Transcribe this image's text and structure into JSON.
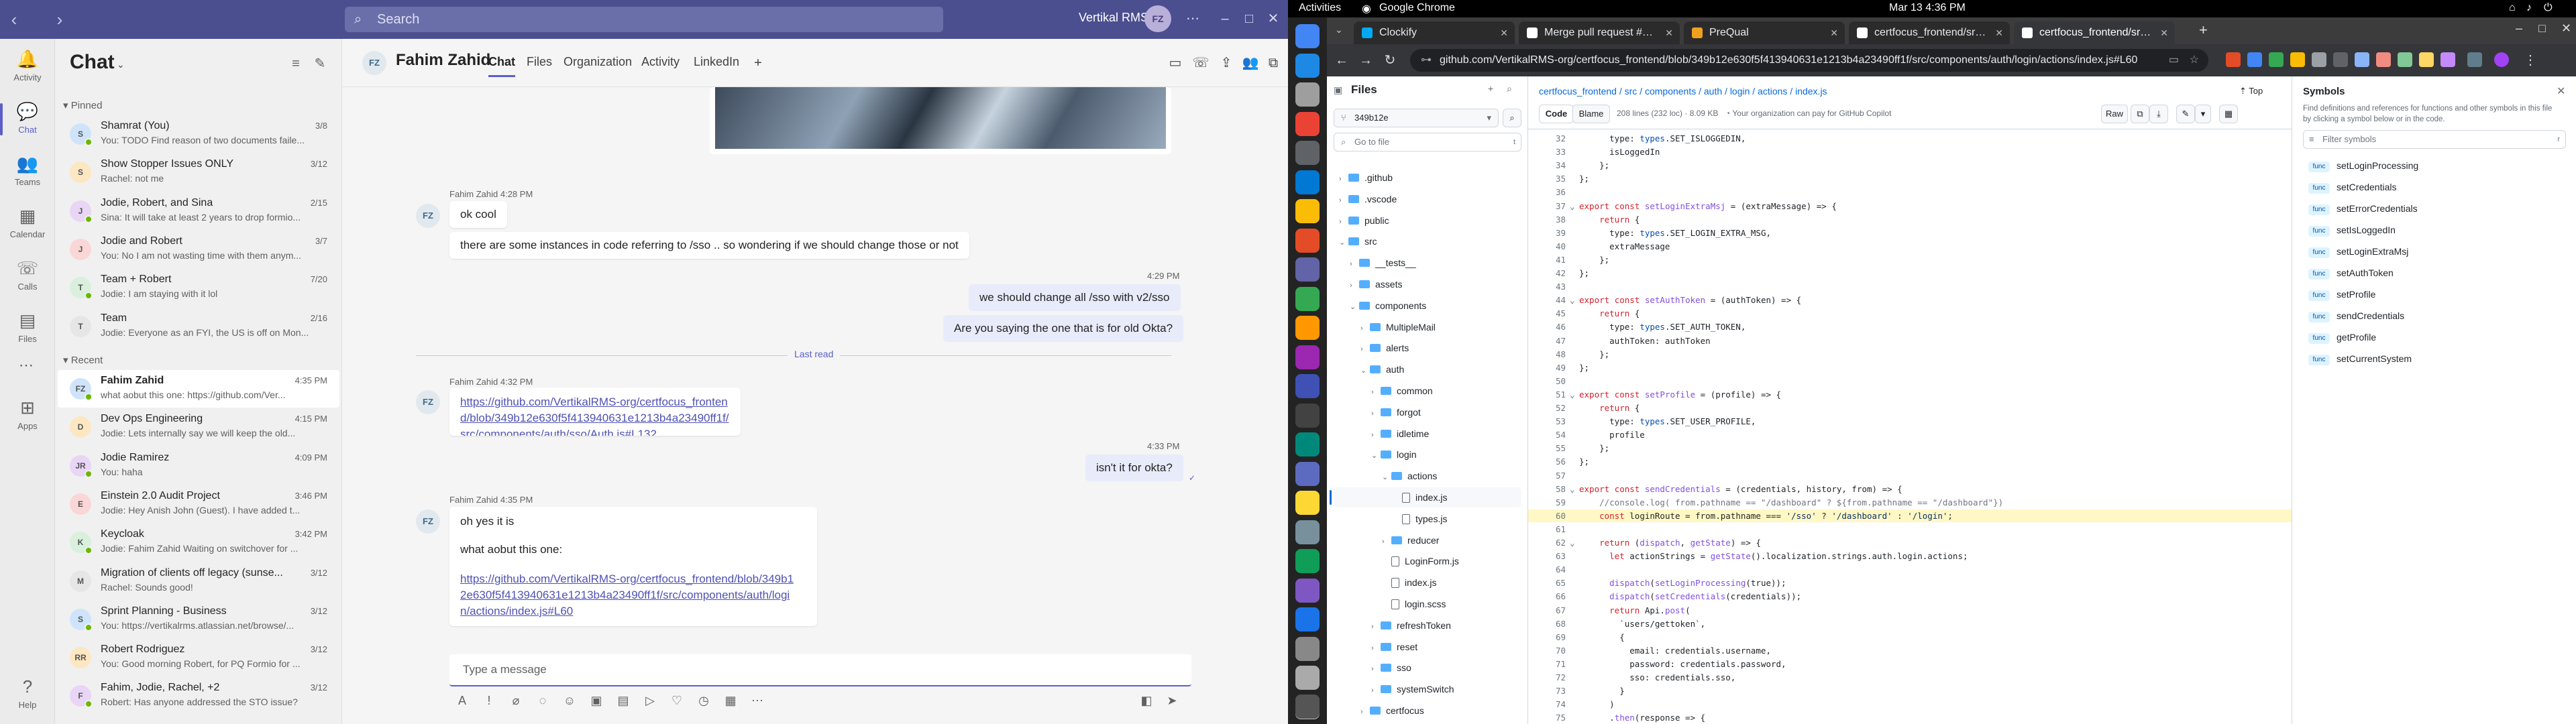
{
  "teams": {
    "titlebar": {
      "search_placeholder": "Search",
      "org": "Vertikal RMS",
      "avatar": "FZ"
    },
    "rail": [
      {
        "label": "Activity",
        "icon": "bell-icon"
      },
      {
        "label": "Chat",
        "icon": "chat-icon"
      },
      {
        "label": "Teams",
        "icon": "teams-icon"
      },
      {
        "label": "Calendar",
        "icon": "calendar-icon"
      },
      {
        "label": "Calls",
        "icon": "phone-icon"
      },
      {
        "label": "Files",
        "icon": "file-icon"
      },
      {
        "label": "Apps",
        "icon": "apps-icon"
      },
      {
        "label": "Help",
        "icon": "help-icon"
      }
    ],
    "list": {
      "title": "Chat",
      "pinned_label": "Pinned",
      "recent_label": "Recent",
      "pinned": [
        {
          "name": "Shamrat (You)",
          "time": "3/8",
          "preview": "You: TODO Find reason of two documents faile...",
          "avatar": "S"
        },
        {
          "name": "Show Stopper Issues ONLY",
          "time": "3/12",
          "preview": "Rachel: not me",
          "avatar": "S"
        },
        {
          "name": "Jodie, Robert, and Sina",
          "time": "2/15",
          "preview": "Sina: It will take at least 2 years to drop formio...",
          "avatar": "J"
        },
        {
          "name": "Jodie and Robert",
          "time": "3/7",
          "preview": "You: No I am not wasting time with them anym...",
          "avatar": "J"
        },
        {
          "name": "Team + Robert",
          "time": "7/20",
          "preview": "Jodie: I am staying with it lol",
          "avatar": "T"
        },
        {
          "name": "Team",
          "time": "2/16",
          "preview": "Jodie: Everyone as an FYI, the US is off on Mon...",
          "avatar": "T"
        }
      ],
      "recent": [
        {
          "name": "Fahim Zahid",
          "time": "4:35 PM",
          "preview": "what aobut this one: https://github.com/Ver...",
          "avatar": "FZ"
        },
        {
          "name": "Dev Ops Engineering",
          "time": "4:15 PM",
          "preview": "Jodie: Lets internally say we will keep the old...",
          "avatar": "D"
        },
        {
          "name": "Jodie Ramirez",
          "time": "4:09 PM",
          "preview": "You: haha",
          "avatar": "JR"
        },
        {
          "name": "Einstein 2.0 Audit Project",
          "time": "3:46 PM",
          "preview": "Jodie: Hey Anish John (Guest). I have added t...",
          "avatar": "E"
        },
        {
          "name": "Keycloak",
          "time": "3:42 PM",
          "preview": "Jodie: Fahim Zahid Waiting on switchover for ...",
          "avatar": "K"
        },
        {
          "name": "Migration of clients off legacy (sunse...",
          "time": "3/12",
          "preview": "Rachel: Sounds good!",
          "avatar": "M"
        },
        {
          "name": "Sprint Planning - Business",
          "time": "3/12",
          "preview": "You: https://vertikalrms.atlassian.net/browse/...",
          "avatar": "S"
        },
        {
          "name": "Robert Rodriguez",
          "time": "3/12",
          "preview": "You: Good morning Robert, for PQ Formio for ...",
          "avatar": "RR"
        },
        {
          "name": "Fahim, Jodie, Rachel, +2",
          "time": "3/12",
          "preview": "Robert: Has anyone addressed the STO issue?",
          "avatar": "F"
        }
      ]
    },
    "chat": {
      "name": "Fahim Zahid",
      "avatar": "FZ",
      "tabs": [
        "Chat",
        "Files",
        "Organization",
        "Activity",
        "LinkedIn"
      ],
      "messages": [
        {
          "side": "left",
          "meta": "Fahim Zahid   4:28 PM",
          "text": "ok cool"
        },
        {
          "side": "left",
          "text": "there are some instances in code referring to /sso .. so wondering if we should change those or not"
        },
        {
          "side": "right",
          "meta": "4:29 PM",
          "text": "we should change all /sso with v2/sso"
        },
        {
          "side": "right",
          "text": "Are you saying the one that is for old Okta?"
        },
        {
          "side": "divider",
          "text": "Last read"
        },
        {
          "side": "left",
          "meta": "Fahim Zahid   4:32 PM",
          "text": "https://github.com/VertikalRMS-org/certfocus_frontend/blob/349b12e630f5f413940631e1213b4a23490ff1f/src/components/auth/sso/Auth.js#L132"
        },
        {
          "side": "right",
          "meta": "4:33 PM",
          "text": "isn't it for okta?"
        },
        {
          "side": "left",
          "meta": "Fahim Zahid   4:35 PM",
          "text": "oh yes it is"
        },
        {
          "side": "left",
          "text": "what aobut this one:"
        },
        {
          "side": "left",
          "text": "https://github.com/VertikalRMS-org/certfocus_frontend/blob/349b12e630f5f413940631e1213b4a23490ff1f/src/components/auth/login/actions/index.js#L60"
        }
      ],
      "compose_placeholder": "Type a message"
    }
  },
  "gnome": {
    "activities": "Activities",
    "app": "Google Chrome",
    "clock": "Mar 13   4:36 PM"
  },
  "chrome": {
    "tabs": [
      {
        "title": "Clockify",
        "color": "#03a9f4"
      },
      {
        "title": "Merge pull request #204 f...",
        "color": "#ffffff"
      },
      {
        "title": "PreQual",
        "color": "#f0a020"
      },
      {
        "title": "certfocus_frontend/src/...",
        "color": "#ffffff"
      },
      {
        "title": "certfocus_frontend/src/...",
        "color": "#ffffff"
      }
    ],
    "url": "github.com/VertikalRMS-org/certfocus_frontend/blob/349b12e630f5f413940631e1213b4a23490ff1f/src/components/auth/login/actions/index.js#L60"
  },
  "github": {
    "files_title": "Files",
    "branch": "349b12e",
    "goto_placeholder": "Go to file",
    "breadcrumb": "certfocus_frontend / src / components / auth / login / actions / index.js",
    "top_label": "Top",
    "code_tab": "Code",
    "blame_tab": "Blame",
    "file_info": "208 lines (232 loc) · 8.09 KB",
    "copilot": "Your organization can pay for GitHub Copilot",
    "raw": "Raw",
    "tree": [
      {
        "name": ".github",
        "depth": 0,
        "type": "dir",
        "open": false
      },
      {
        "name": ".vscode",
        "depth": 0,
        "type": "dir",
        "open": false
      },
      {
        "name": "public",
        "depth": 0,
        "type": "dir",
        "open": false
      },
      {
        "name": "src",
        "depth": 0,
        "type": "dir",
        "open": true
      },
      {
        "name": "__tests__",
        "depth": 1,
        "type": "dir",
        "open": false
      },
      {
        "name": "assets",
        "depth": 1,
        "type": "dir",
        "open": false
      },
      {
        "name": "components",
        "depth": 1,
        "type": "dir",
        "open": true
      },
      {
        "name": "MultipleMail",
        "depth": 2,
        "type": "dir",
        "open": false
      },
      {
        "name": "alerts",
        "depth": 2,
        "type": "dir",
        "open": false
      },
      {
        "name": "auth",
        "depth": 2,
        "type": "dir",
        "open": true
      },
      {
        "name": "common",
        "depth": 3,
        "type": "dir",
        "open": false
      },
      {
        "name": "forgot",
        "depth": 3,
        "type": "dir",
        "open": false
      },
      {
        "name": "idletime",
        "depth": 3,
        "type": "dir",
        "open": false
      },
      {
        "name": "login",
        "depth": 3,
        "type": "dir",
        "open": true
      },
      {
        "name": "actions",
        "depth": 4,
        "type": "dir",
        "open": true
      },
      {
        "name": "index.js",
        "depth": 5,
        "type": "file",
        "sel": true
      },
      {
        "name": "types.js",
        "depth": 5,
        "type": "file"
      },
      {
        "name": "reducer",
        "depth": 4,
        "type": "dir",
        "open": false
      },
      {
        "name": "LoginForm.js",
        "depth": 4,
        "type": "file"
      },
      {
        "name": "index.js",
        "depth": 4,
        "type": "file"
      },
      {
        "name": "login.scss",
        "depth": 4,
        "type": "file"
      },
      {
        "name": "refreshToken",
        "depth": 3,
        "type": "dir",
        "open": false
      },
      {
        "name": "reset",
        "depth": 3,
        "type": "dir",
        "open": false
      },
      {
        "name": "sso",
        "depth": 3,
        "type": "dir",
        "open": false
      },
      {
        "name": "systemSwitch",
        "depth": 3,
        "type": "dir",
        "open": false
      },
      {
        "name": "certfocus",
        "depth": 2,
        "type": "dir",
        "open": false
      }
    ],
    "code": [
      {
        "n": "32",
        "t": "      type: types.SET_ISLOGGEDIN,"
      },
      {
        "n": "33",
        "t": "      isLoggedIn"
      },
      {
        "n": "34",
        "t": "    };"
      },
      {
        "n": "35",
        "t": "};"
      },
      {
        "n": "36",
        "t": ""
      },
      {
        "n": "37",
        "t": "export const setLoginExtraMsj = (extraMessage) => {"
      },
      {
        "n": "38",
        "t": "    return {"
      },
      {
        "n": "39",
        "t": "      type: types.SET_LOGIN_EXTRA_MSG,"
      },
      {
        "n": "40",
        "t": "      extraMessage"
      },
      {
        "n": "41",
        "t": "    };"
      },
      {
        "n": "42",
        "t": "};"
      },
      {
        "n": "43",
        "t": ""
      },
      {
        "n": "44",
        "t": "export const setAuthToken = (authToken) => {"
      },
      {
        "n": "45",
        "t": "    return {"
      },
      {
        "n": "46",
        "t": "      type: types.SET_AUTH_TOKEN,"
      },
      {
        "n": "47",
        "t": "      authToken: authToken"
      },
      {
        "n": "48",
        "t": "    };"
      },
      {
        "n": "49",
        "t": "};"
      },
      {
        "n": "50",
        "t": ""
      },
      {
        "n": "51",
        "t": "export const setProfile = (profile) => {"
      },
      {
        "n": "52",
        "t": "    return {"
      },
      {
        "n": "53",
        "t": "      type: types.SET_USER_PROFILE,"
      },
      {
        "n": "54",
        "t": "      profile"
      },
      {
        "n": "55",
        "t": "    };"
      },
      {
        "n": "56",
        "t": "};"
      },
      {
        "n": "57",
        "t": ""
      },
      {
        "n": "58",
        "t": "export const sendCredentials = (credentials, history, from) => {"
      },
      {
        "n": "59",
        "t": "    //console.log( from.pathname == \"/dashboard\" ? ${from.pathname == \"/dashboard\"})"
      },
      {
        "n": "60",
        "t": "    const loginRoute = from.pathname === '/sso' ? '/dashboard' : '/login';"
      },
      {
        "n": "61",
        "t": ""
      },
      {
        "n": "62",
        "t": "    return (dispatch, getState) => {"
      },
      {
        "n": "63",
        "t": "      let actionStrings = getState().localization.strings.auth.login.actions;"
      },
      {
        "n": "64",
        "t": ""
      },
      {
        "n": "65",
        "t": "      dispatch(setLoginProcessing(true));"
      },
      {
        "n": "66",
        "t": "      dispatch(setCredentials(credentials));"
      },
      {
        "n": "67",
        "t": "      return Api.post("
      },
      {
        "n": "68",
        "t": "        `users/gettoken`,"
      },
      {
        "n": "69",
        "t": "        {"
      },
      {
        "n": "70",
        "t": "          email: credentials.username,"
      },
      {
        "n": "71",
        "t": "          password: credentials.password,"
      },
      {
        "n": "72",
        "t": "          sso: credentials.sso,"
      },
      {
        "n": "73",
        "t": "        }"
      },
      {
        "n": "74",
        "t": "      )"
      },
      {
        "n": "75",
        "t": "      .then(response => {"
      }
    ],
    "symbols": {
      "title": "Symbols",
      "desc": "Find definitions and references for functions and other symbols in this file by clicking a symbol below or in the code.",
      "filter_placeholder": "Filter symbols",
      "badge": "func",
      "items": [
        "setLoginProcessing",
        "setCredentials",
        "setErrorCredentials",
        "setIsLoggedIn",
        "setLoginExtraMsj",
        "setAuthToken",
        "setProfile",
        "sendCredentials",
        "getProfile",
        "setCurrentSystem"
      ]
    }
  }
}
